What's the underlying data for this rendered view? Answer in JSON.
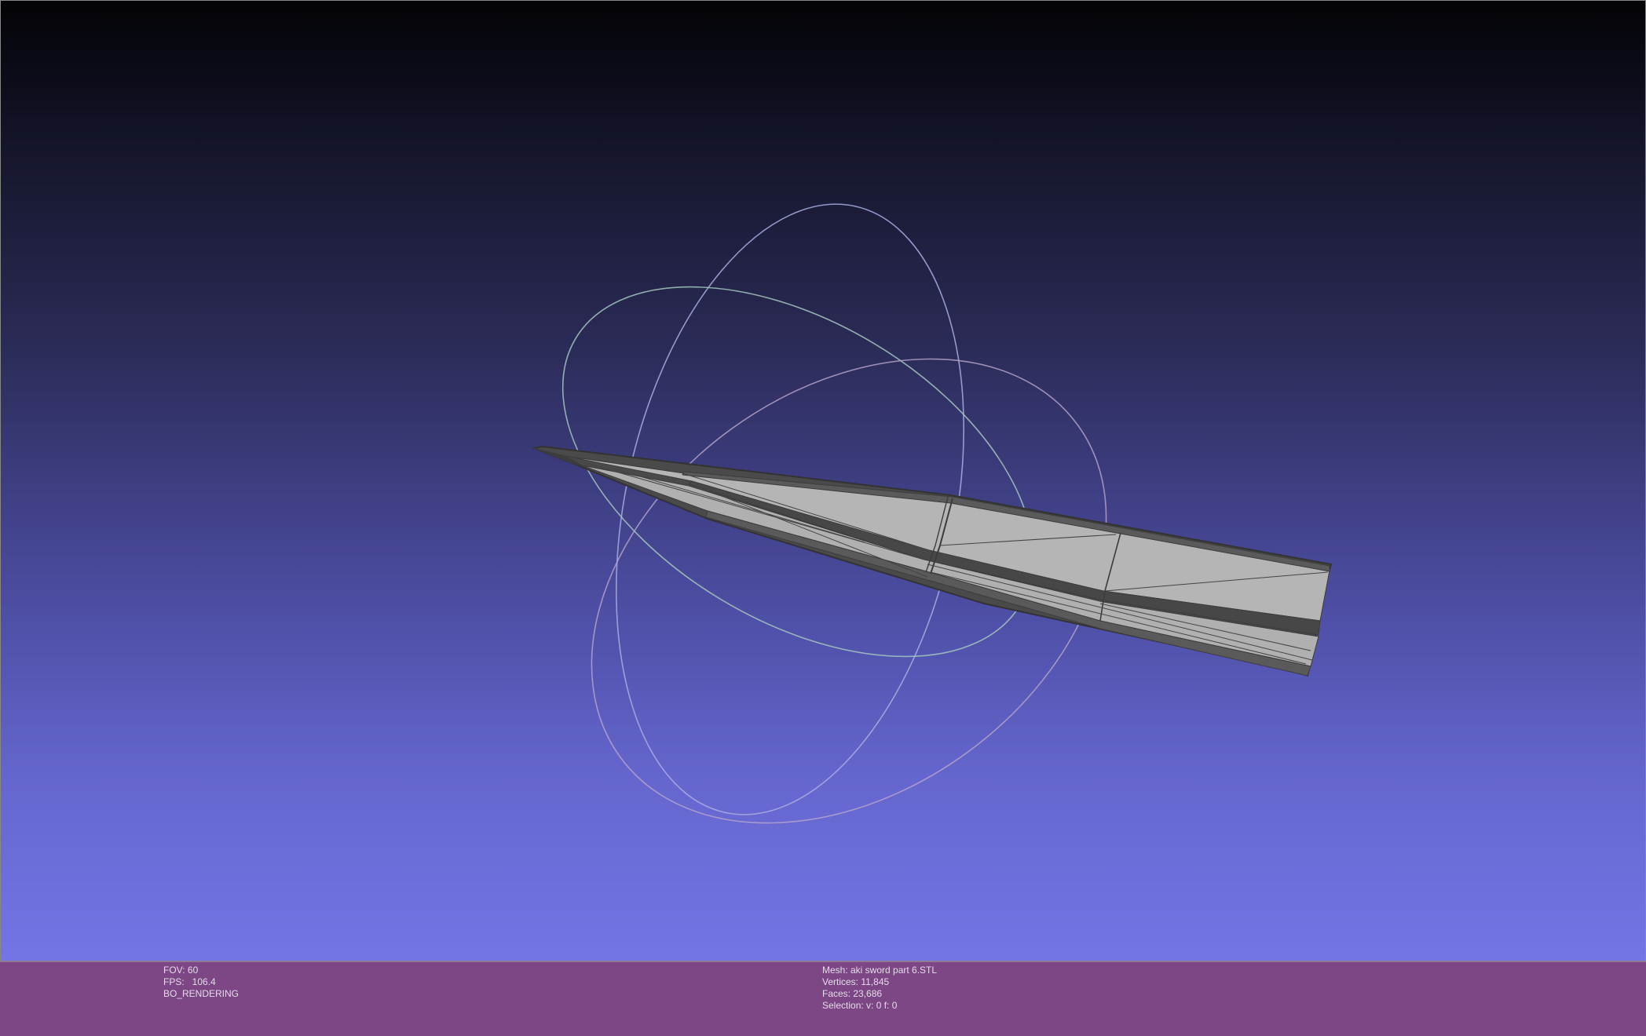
{
  "viewport": {
    "background_top": "#030306",
    "background_bottom": "#7475e6",
    "trackball": {
      "ring_colors": [
        "#a8b0e0",
        "#9eb8b4",
        "#b8a0c8"
      ]
    },
    "mesh": {
      "fill_color": "#b4b4b4",
      "edge_color": "#3c3c3c"
    }
  },
  "status": {
    "bar_color": "#7c4784",
    "left": {
      "fov": "FOV: 60",
      "fps": "FPS:   106.4",
      "mode": "BO_RENDERING"
    },
    "center": {
      "mesh": "Mesh: aki sword part 6.STL",
      "vertices": "Vertices: 11,845",
      "faces": "Faces: 23,686",
      "selection": "Selection: v: 0 f: 0"
    }
  }
}
